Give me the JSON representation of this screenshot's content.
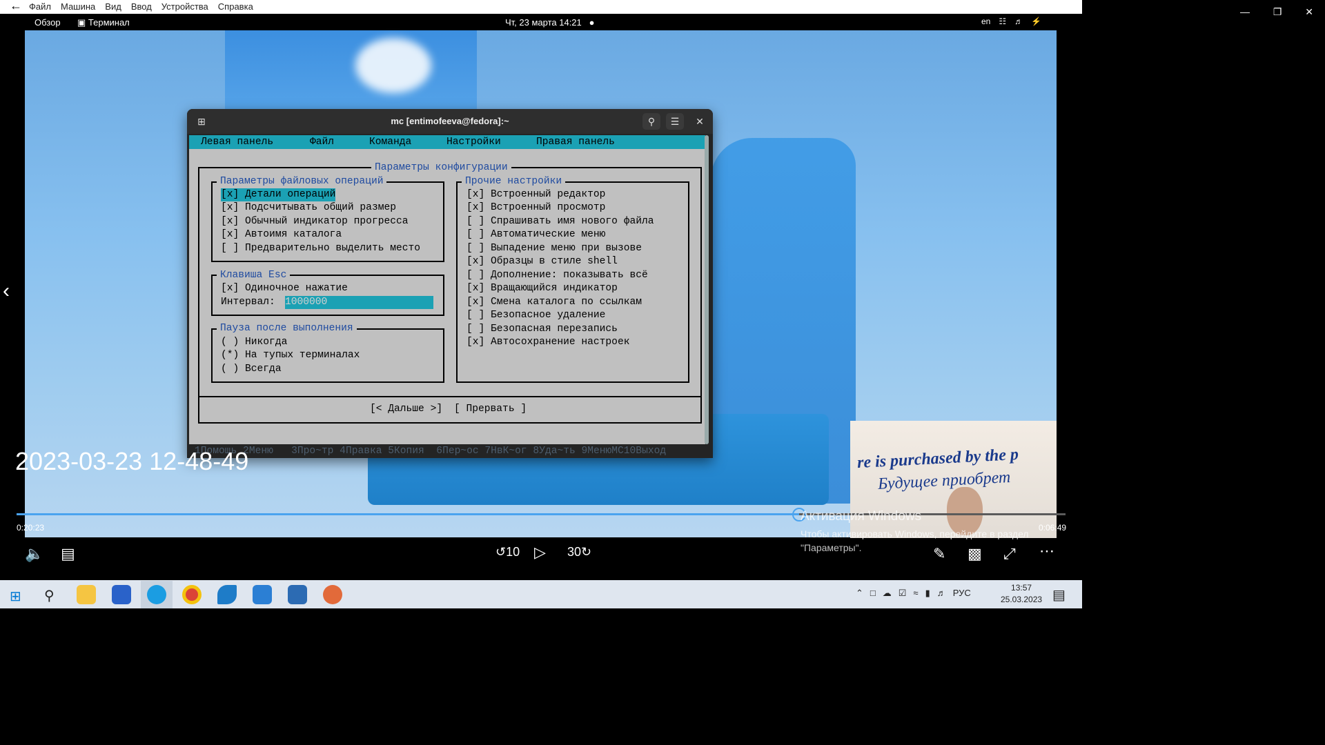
{
  "top_menu": {
    "items": [
      "Файл",
      "Машина",
      "Вид",
      "Ввод",
      "Устройства",
      "Справка"
    ]
  },
  "gnome_bar": {
    "overview": "Обзор",
    "app": "Терминал",
    "clock": "Чт, 23 марта  14:21",
    "lang": "en"
  },
  "terminal": {
    "title": "mc [entimofeeva@fedora]:~"
  },
  "mc": {
    "menubar": [
      "Левая панель",
      "Файл",
      "Команда",
      "Настройки",
      "Правая панель"
    ],
    "dialog_title": "Параметры конфигурации",
    "file_ops": {
      "title": "Параметры файловых операций",
      "items": [
        "[x] Детали операций",
        "[x] Подсчитывать общий размер",
        "[x] Обычный индикатор прогресса",
        "[x] Автоимя каталога",
        "[ ] Предварительно выделить место"
      ]
    },
    "esc": {
      "title": "Клавиша Esc",
      "single": "[x] Одиночное нажатие",
      "interval_label": "Интервал:",
      "interval_value": "1000000"
    },
    "pause": {
      "title": "Пауза после выполнения",
      "items": [
        "( ) Никогда",
        "(*) На тупых терминалах",
        "( ) Всегда"
      ]
    },
    "other": {
      "title": "Прочие настройки",
      "items": [
        "[x] Встроенный редактор",
        "[x] Встроенный просмотр",
        "[ ] Спрашивать имя нового файла",
        "[ ] Автоматические меню",
        "[ ] Выпадение меню при вызове",
        "[x] Образцы в стиле shell",
        "[ ] Дополнение: показывать всё",
        "[x] Вращающийся индикатор",
        "[x] Смена каталога по ссылкам",
        "[ ] Безопасное удаление",
        "[ ] Безопасная перезапись",
        "[x] Автосохранение настроек"
      ]
    },
    "buttons": {
      "next": "[< Дальше >]",
      "cancel": "[ Прервать ]"
    },
    "fkeys": "1Помощь 2Меню   3Про~тр 4Правка 5Копия  6Пер~ос 7НвК~ог 8Уда~ть 9МенюMC10Выход"
  },
  "video": {
    "timestamp": "2023-03-23 12-48-49",
    "elapsed": "0:20:23",
    "remaining": "0:06:49",
    "progress": 0.746,
    "ad_line1": "re is purchased by the p",
    "ad_line2": "Будущее приобрет"
  },
  "activation": {
    "title": "Активация Windows",
    "text": "Чтобы активировать Windows, перейдите в раздел \"Параметры\"."
  },
  "taskbar": {
    "lang": "РУС",
    "time": "13:57",
    "date": "25.03.2023"
  }
}
